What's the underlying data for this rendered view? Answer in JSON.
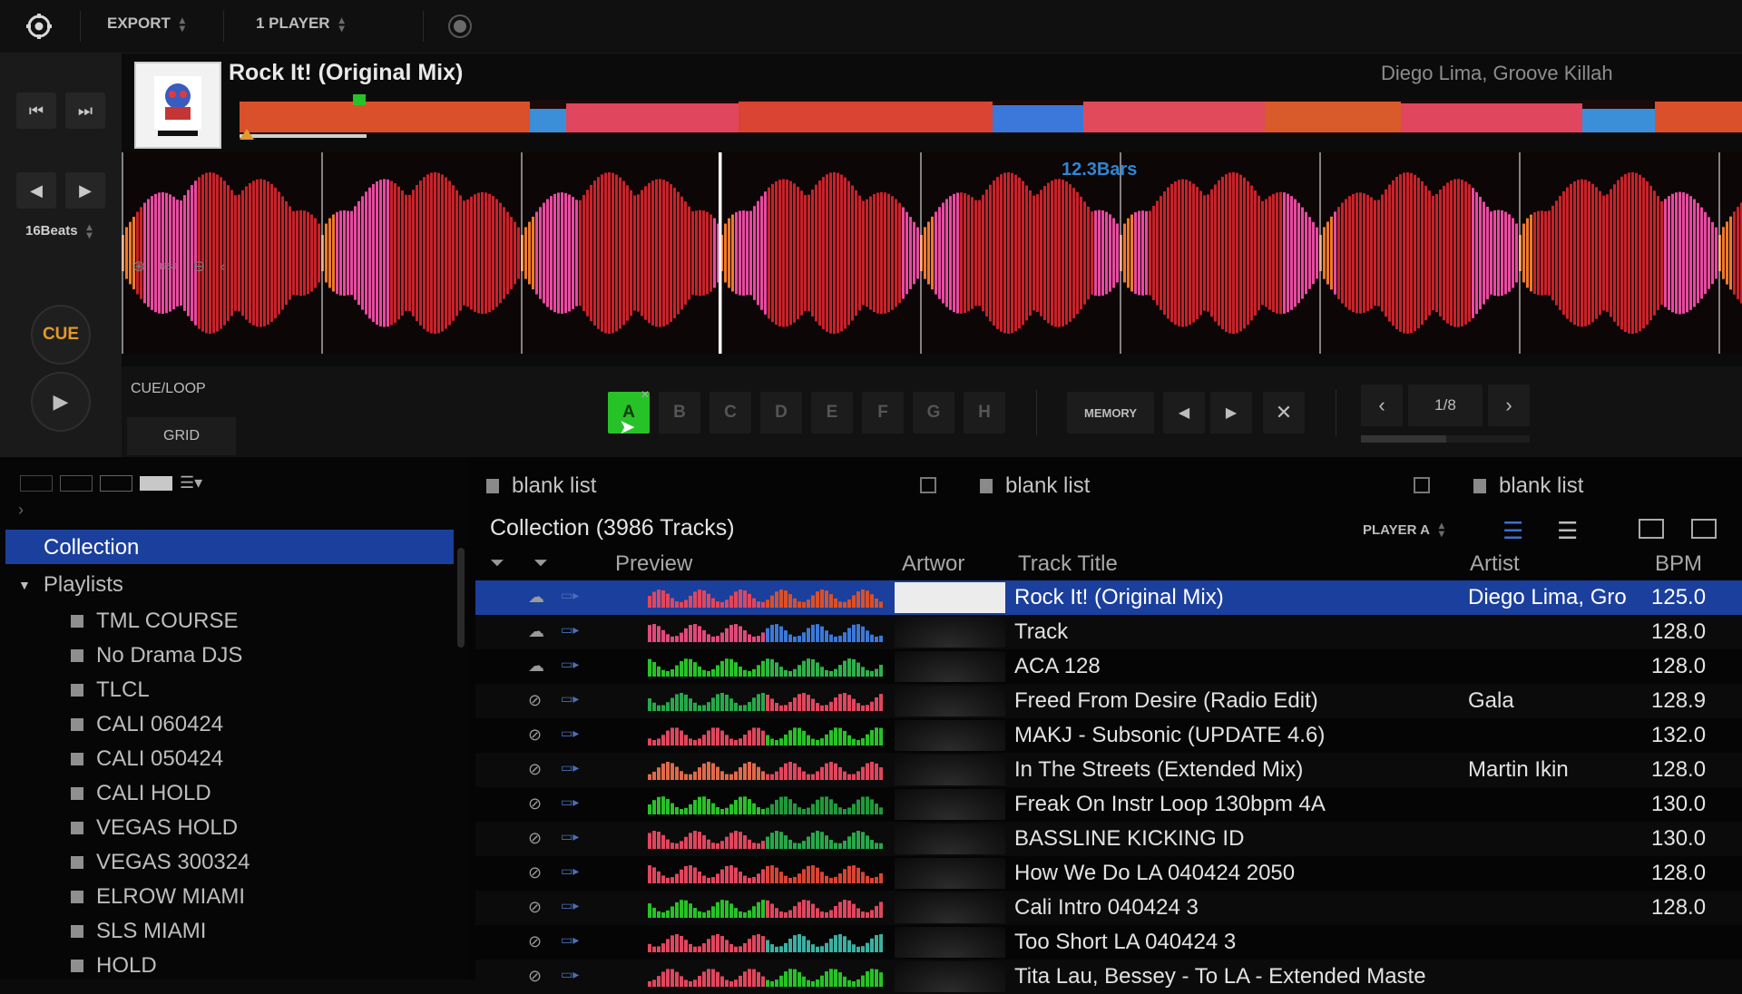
{
  "topbar": {
    "export_label": "EXPORT",
    "player_mode_label": "1 PLAYER"
  },
  "deck": {
    "title": "Rock It! (Original Mix)",
    "artist": "Diego Lima, Groove Killah",
    "beat_jump_label": "16Beats",
    "bars_label": "12.3Bars",
    "cue_label": "CUE",
    "cue_loop_tab": "CUE/LOOP",
    "grid_tab": "GRID",
    "zoom_reset_label": "RST"
  },
  "hot_cues": [
    "A",
    "B",
    "C",
    "D",
    "E",
    "F",
    "G",
    "H"
  ],
  "memory_label": "MEMORY",
  "page_indicator": "1/8",
  "browser": {
    "list_tabs": [
      "blank list",
      "blank list",
      "blank list"
    ],
    "collection_header": "Collection (3986 Tracks)",
    "player_select": "PLAYER A",
    "sidebar": {
      "collection_label": "Collection",
      "playlists_label": "Playlists",
      "playlists": [
        "TML COURSE",
        "No Drama DJS",
        "TLCL",
        "CALI 060424",
        "CALI 050424",
        "CALI HOLD",
        "VEGAS HOLD",
        "VEGAS 300324",
        "ELROW MIAMI",
        "SLS MIAMI",
        "HOLD"
      ]
    },
    "columns": {
      "preview": "Preview",
      "artwork": "Artwor",
      "title": "Track Title",
      "artist": "Artist",
      "bpm": "BPM"
    },
    "tracks": [
      {
        "title": "Rock It! (Original Mix)",
        "artist": "Diego Lima, Gro",
        "bpm": "125.0"
      },
      {
        "title": "Track",
        "artist": "",
        "bpm": "128.0"
      },
      {
        "title": "ACA 128",
        "artist": "",
        "bpm": "128.0"
      },
      {
        "title": "Freed From Desire (Radio Edit)",
        "artist": "Gala",
        "bpm": "128.9"
      },
      {
        "title": "MAKJ - Subsonic (UPDATE 4.6)",
        "artist": "",
        "bpm": "132.0"
      },
      {
        "title": "In The Streets (Extended Mix)",
        "artist": "Martin Ikin",
        "bpm": "128.0"
      },
      {
        "title": "Freak On Instr Loop 130bpm 4A",
        "artist": "",
        "bpm": "130.0"
      },
      {
        "title": "BASSLINE KICKING ID",
        "artist": "",
        "bpm": "130.0"
      },
      {
        "title": "How We Do LA 040424 2050",
        "artist": "",
        "bpm": "128.0"
      },
      {
        "title": "Cali Intro 040424 3",
        "artist": "",
        "bpm": "128.0"
      },
      {
        "title": "Too Short LA 040424 3",
        "artist": "",
        "bpm": ""
      },
      {
        "title": "Tita Lau, Bessey - To LA - Extended Maste",
        "artist": "",
        "bpm": ""
      }
    ]
  },
  "colors": {
    "accent_blue": "#1b3f9c",
    "hotcue_green": "#27c227",
    "cue_orange": "#e29a2a",
    "bars_blue": "#2f86d4"
  }
}
